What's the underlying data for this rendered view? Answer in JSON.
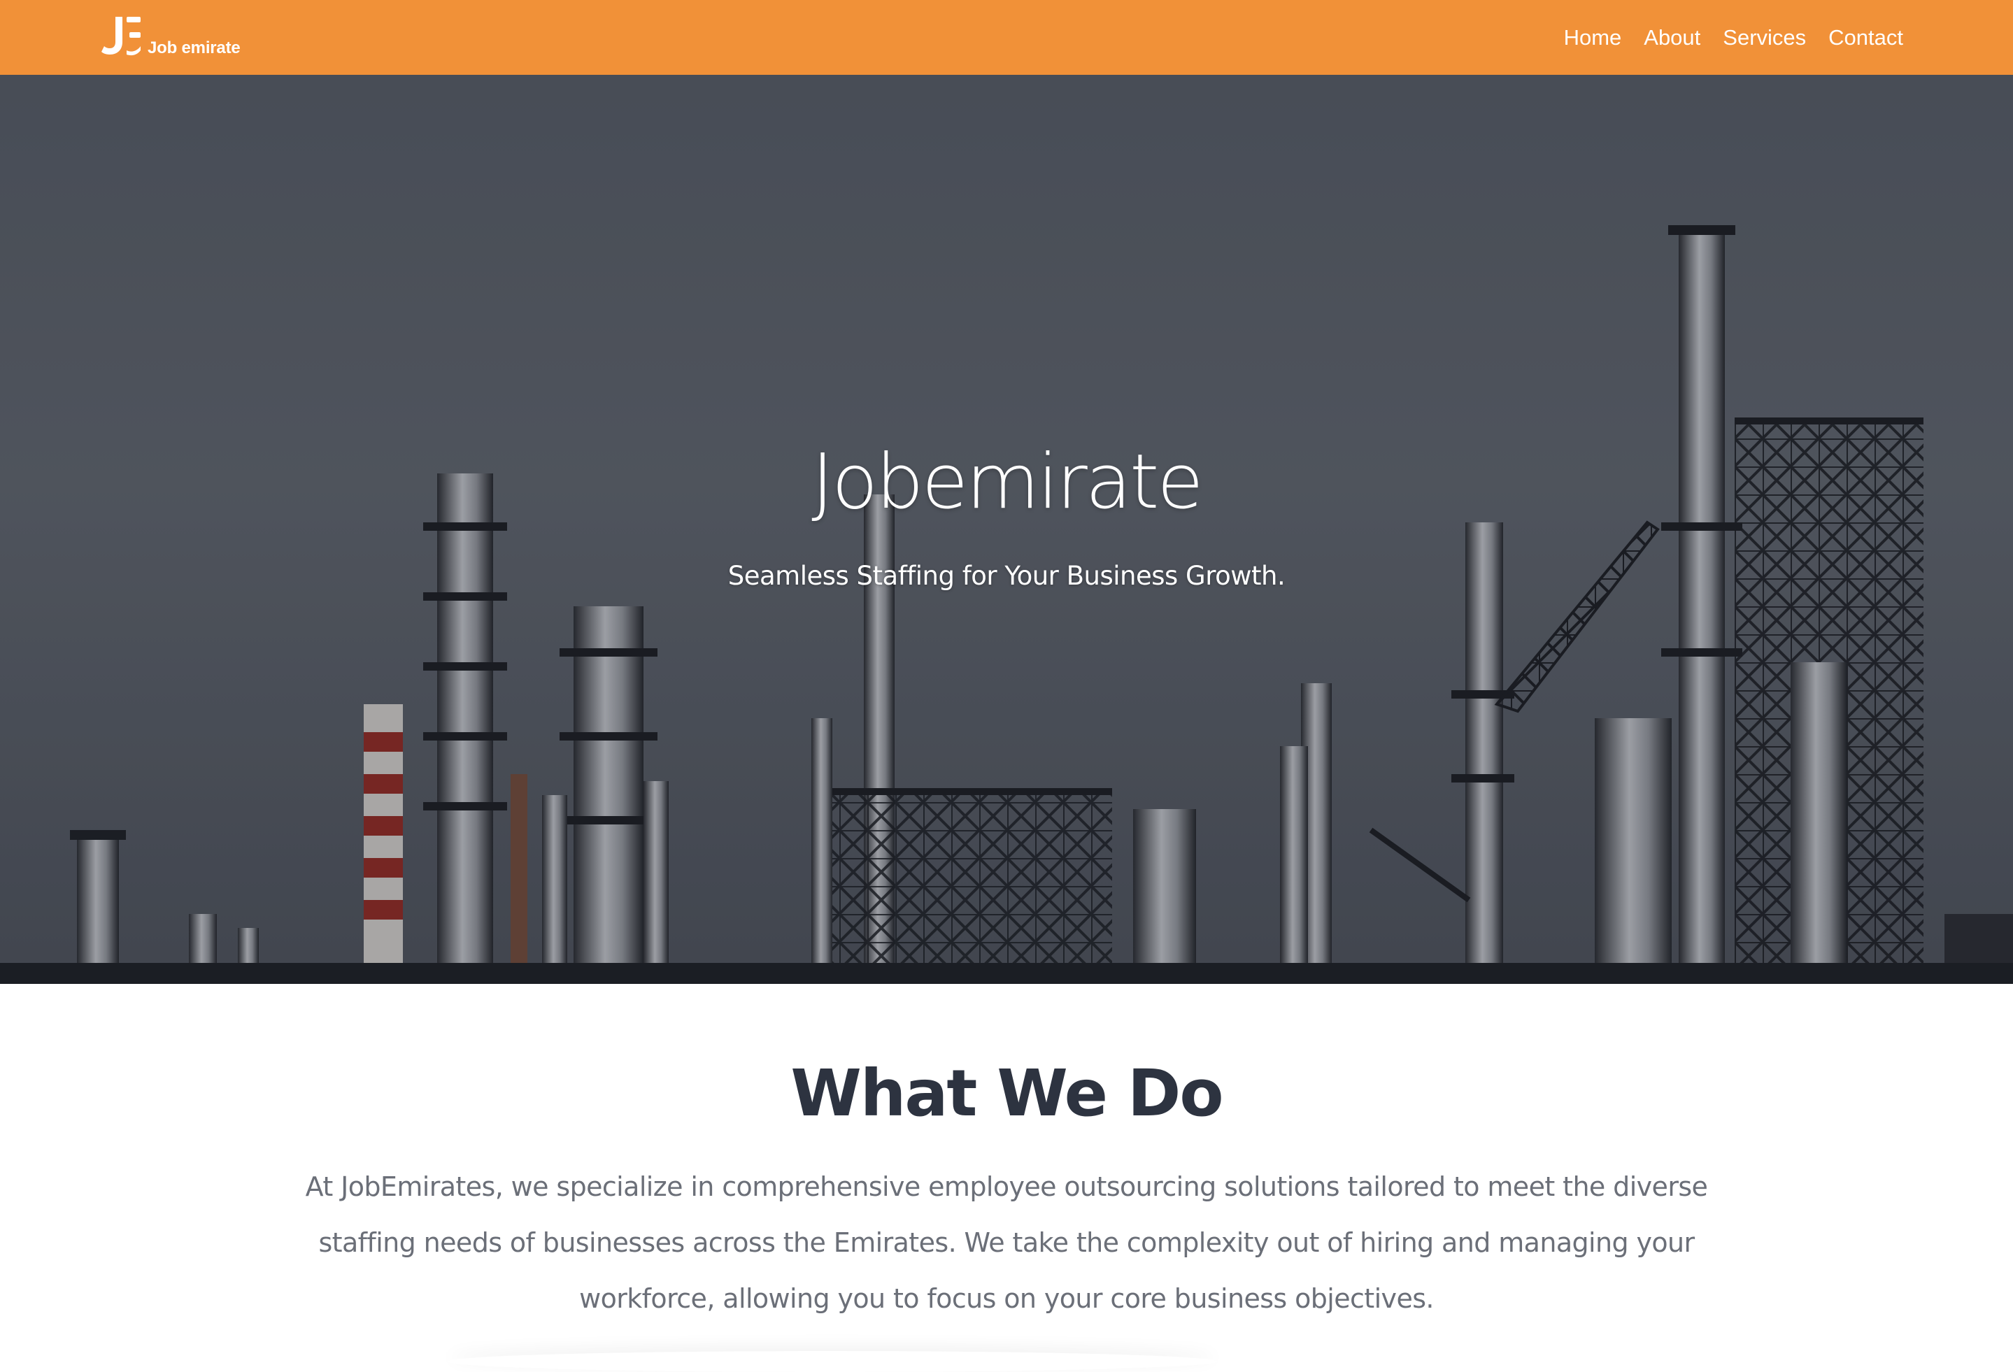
{
  "brand": {
    "logo_text": "Job emirate",
    "logo_icon": "je-monogram-icon"
  },
  "nav": {
    "items": [
      {
        "label": "Home"
      },
      {
        "label": "About"
      },
      {
        "label": "Services"
      },
      {
        "label": "Contact"
      }
    ]
  },
  "hero": {
    "title": "Jobemirate",
    "subtitle": "Seamless Staffing for Your Business Growth."
  },
  "what_we_do": {
    "heading": "What We Do",
    "body": "At JobEmirates, we specialize in comprehensive employee outsourcing solutions tailored to meet the diverse staffing needs of businesses across the Emirates. We take the complexity out of hiring and managing your workforce, allowing you to focus on your core business objectives."
  },
  "colors": {
    "brand_orange": "#f19138",
    "heading_dark": "#2d3340",
    "body_gray": "#6b6f78"
  }
}
